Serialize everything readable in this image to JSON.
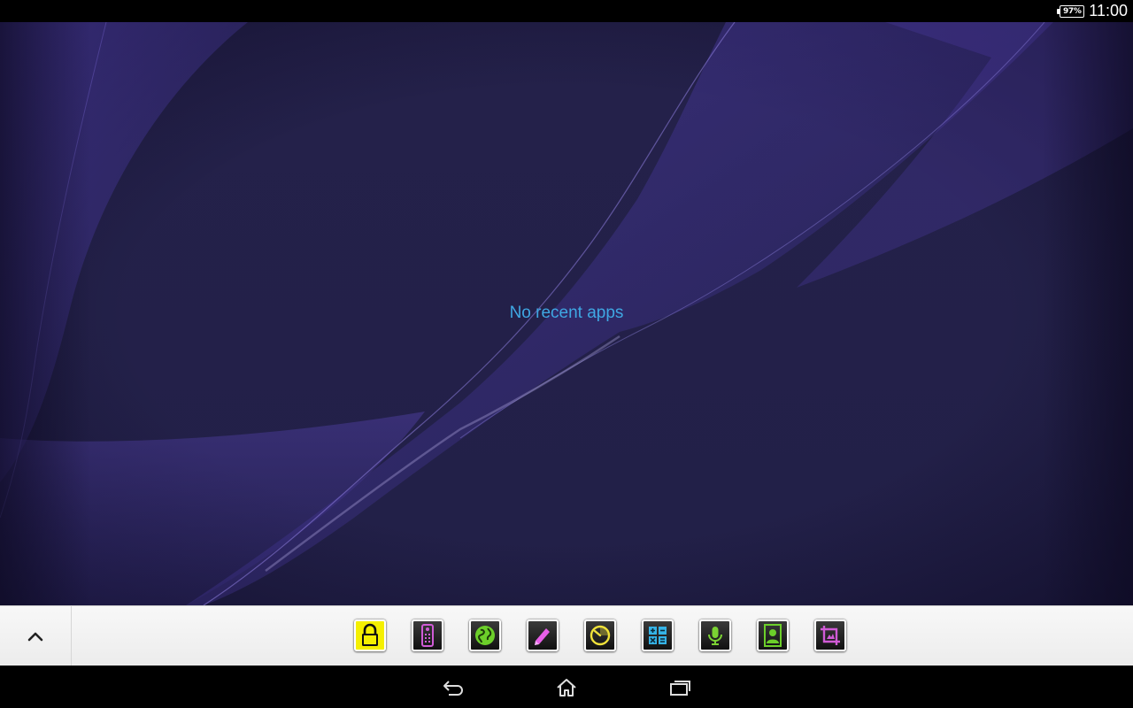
{
  "status_bar": {
    "battery_level": "97%",
    "battery_fraction": 0.97,
    "time": "11:00"
  },
  "recents": {
    "empty_message": "No recent apps"
  },
  "small_apps": {
    "items": [
      {
        "icon": "lock-icon",
        "color": "#f5f000"
      },
      {
        "icon": "remote-control-icon",
        "color": "#d05bd6"
      },
      {
        "icon": "browser-globe-icon",
        "color": "#6ccf2a"
      },
      {
        "icon": "pen-note-icon",
        "color": "#e85fe8"
      },
      {
        "icon": "timer-dial-icon",
        "color": "#f0e23a"
      },
      {
        "icon": "calculator-icon",
        "color": "#35b3e6"
      },
      {
        "icon": "microphone-icon",
        "color": "#7bd233"
      },
      {
        "icon": "contact-icon",
        "color": "#6ccf2a"
      },
      {
        "icon": "screen-crop-icon",
        "color": "#d05bd6"
      }
    ]
  },
  "navigation": {
    "back": "back-icon",
    "home": "home-icon",
    "recents": "recent-apps-icon"
  },
  "colors": {
    "accent_text": "#3fa7e3",
    "wallpaper_base": "#23204a",
    "wallpaper_wave": "#4b3aa0"
  }
}
